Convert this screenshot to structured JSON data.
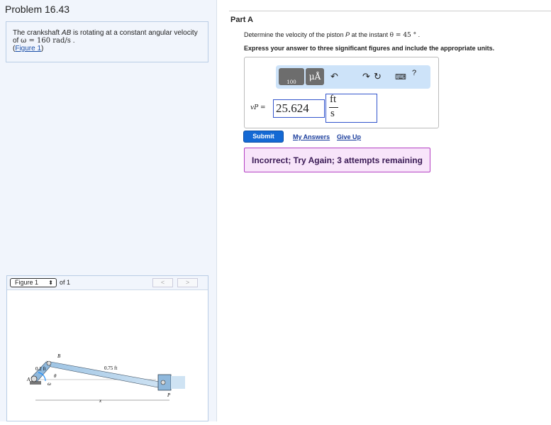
{
  "problem": {
    "title": "Problem 16.43",
    "text_pre": "The crankshaft ",
    "text_ab": "AB",
    "text_mid": " is rotating at a constant angular velocity of ",
    "omega_expr": "ω = 160 rad/s",
    "text_end": " .",
    "figure_link_open": "(",
    "figure_link": "Figure 1",
    "figure_link_close": ")"
  },
  "figure": {
    "select_value": "Figure 1",
    "of_label": "of 1",
    "prev": "<",
    "next": ">",
    "labels": {
      "B": "B",
      "A": "A",
      "P": "P",
      "ab_len": "0.2 ft",
      "bc_len": "0.75 ft",
      "theta": "θ",
      "omega": "ω",
      "x": "x"
    }
  },
  "part": {
    "title": "Part A",
    "question_pre": "Determine the velocity of the piston ",
    "question_p": "P",
    "question_mid": " at the instant ",
    "theta_expr": "θ = 45 °",
    "question_end": " .",
    "instruction": "Express your answer to three significant figures and include the appropriate units."
  },
  "toolbar": {
    "templates": "100",
    "units": "μÅ",
    "undo": "↶",
    "redo": "↷",
    "reset": "↻",
    "keyboard": "⌨",
    "help": "?"
  },
  "answer": {
    "label": "vP =",
    "value": "25.624",
    "unit_num": "ft",
    "unit_den": "s"
  },
  "actions": {
    "submit": "Submit",
    "my_answers": "My Answers",
    "give_up": "Give Up"
  },
  "feedback": "Incorrect; Try Again; 3 attempts remaining"
}
